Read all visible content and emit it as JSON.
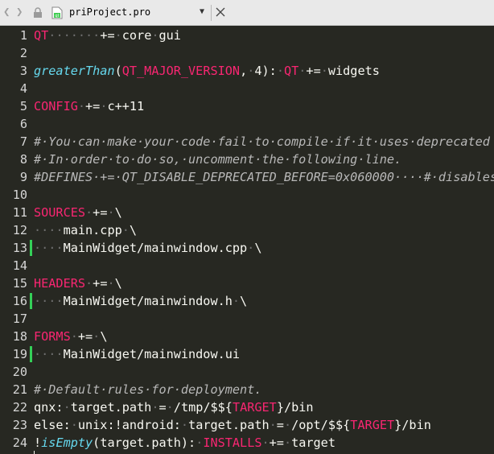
{
  "tabbar": {
    "filename": "priProject.pro",
    "back_icon": "chevron-left-icon",
    "forward_icon": "chevron-right-icon",
    "lock_icon": "lock-icon",
    "file_icon": "qt-project-file-icon",
    "dropdown_icon": "triangle-down-icon",
    "close_icon": "close-icon"
  },
  "colors": {
    "background": "#272822",
    "keyword": "#f92672",
    "function": "#66d9ef",
    "text": "#f8f8f2",
    "comment": "#b8b8b8",
    "whitespace_dot": "#6e6e6e",
    "modified_marker": "#34d058"
  },
  "lines": [
    {
      "n": "1",
      "modified": false,
      "tokens": [
        [
          "kw",
          "QT"
        ],
        [
          "dot",
          "·······"
        ],
        [
          "ph",
          "+="
        ],
        [
          "dot",
          "·"
        ],
        [
          "ph",
          "core"
        ],
        [
          "dot",
          "·"
        ],
        [
          "ph",
          "gui"
        ]
      ]
    },
    {
      "n": "2",
      "modified": false,
      "tokens": []
    },
    {
      "n": "3",
      "modified": false,
      "tokens": [
        [
          "fn",
          "greaterThan"
        ],
        [
          "ph",
          "("
        ],
        [
          "kw",
          "QT_MAJOR_VERSION"
        ],
        [
          "ph",
          ","
        ],
        [
          "dot",
          "·"
        ],
        [
          "ph",
          "4):"
        ],
        [
          "dot",
          "·"
        ],
        [
          "kw",
          "QT"
        ],
        [
          "dot",
          "·"
        ],
        [
          "ph",
          "+="
        ],
        [
          "dot",
          "·"
        ],
        [
          "ph",
          "widgets"
        ]
      ]
    },
    {
      "n": "4",
      "modified": false,
      "tokens": []
    },
    {
      "n": "5",
      "modified": false,
      "tokens": [
        [
          "kw",
          "CONFIG"
        ],
        [
          "dot",
          "·"
        ],
        [
          "ph",
          "+="
        ],
        [
          "dot",
          "·"
        ],
        [
          "ph",
          "c++11"
        ]
      ]
    },
    {
      "n": "6",
      "modified": false,
      "tokens": []
    },
    {
      "n": "7",
      "modified": false,
      "tokens": [
        [
          "cm",
          "#·You·can·make·your·code·fail·to·compile·if·it·uses·deprecated"
        ]
      ]
    },
    {
      "n": "8",
      "modified": false,
      "tokens": [
        [
          "cm",
          "#·In·order·to·do·so,·uncomment·the·following·line."
        ]
      ]
    },
    {
      "n": "9",
      "modified": false,
      "tokens": [
        [
          "cm",
          "#DEFINES·+=·QT_DISABLE_DEPRECATED_BEFORE=0x060000····#·disables"
        ]
      ]
    },
    {
      "n": "10",
      "modified": false,
      "tokens": []
    },
    {
      "n": "11",
      "modified": false,
      "tokens": [
        [
          "kw",
          "SOURCES"
        ],
        [
          "dot",
          "·"
        ],
        [
          "ph",
          "+="
        ],
        [
          "dot",
          "·"
        ],
        [
          "ph",
          "\\"
        ]
      ]
    },
    {
      "n": "12",
      "modified": false,
      "tokens": [
        [
          "dot",
          "····"
        ],
        [
          "ph",
          "main.cpp"
        ],
        [
          "dot",
          "·"
        ],
        [
          "ph",
          "\\"
        ]
      ]
    },
    {
      "n": "13",
      "modified": true,
      "tokens": [
        [
          "dot",
          "····"
        ],
        [
          "ph",
          "MainWidget/mainwindow.cpp"
        ],
        [
          "dot",
          "·"
        ],
        [
          "ph",
          "\\"
        ]
      ]
    },
    {
      "n": "14",
      "modified": false,
      "tokens": []
    },
    {
      "n": "15",
      "modified": false,
      "tokens": [
        [
          "kw",
          "HEADERS"
        ],
        [
          "dot",
          "·"
        ],
        [
          "ph",
          "+="
        ],
        [
          "dot",
          "·"
        ],
        [
          "ph",
          "\\"
        ]
      ]
    },
    {
      "n": "16",
      "modified": true,
      "tokens": [
        [
          "dot",
          "····"
        ],
        [
          "ph",
          "MainWidget/mainwindow.h"
        ],
        [
          "dot",
          "·"
        ],
        [
          "ph",
          "\\"
        ]
      ]
    },
    {
      "n": "17",
      "modified": false,
      "tokens": []
    },
    {
      "n": "18",
      "modified": false,
      "tokens": [
        [
          "kw",
          "FORMS"
        ],
        [
          "dot",
          "·"
        ],
        [
          "ph",
          "+="
        ],
        [
          "dot",
          "·"
        ],
        [
          "ph",
          "\\"
        ]
      ]
    },
    {
      "n": "19",
      "modified": true,
      "tokens": [
        [
          "dot",
          "····"
        ],
        [
          "ph",
          "MainWidget/mainwindow.ui"
        ]
      ]
    },
    {
      "n": "20",
      "modified": false,
      "tokens": []
    },
    {
      "n": "21",
      "modified": false,
      "tokens": [
        [
          "cm",
          "#·Default·rules·for·deployment."
        ]
      ]
    },
    {
      "n": "22",
      "modified": false,
      "tokens": [
        [
          "ph",
          "qnx:"
        ],
        [
          "dot",
          "·"
        ],
        [
          "ph",
          "target.path"
        ],
        [
          "dot",
          "·"
        ],
        [
          "ph",
          "="
        ],
        [
          "dot",
          "·"
        ],
        [
          "ph",
          "/tmp/$${"
        ],
        [
          "kw",
          "TARGET"
        ],
        [
          "ph",
          "}/bin"
        ]
      ]
    },
    {
      "n": "23",
      "modified": false,
      "tokens": [
        [
          "ph",
          "else:"
        ],
        [
          "dot",
          "·"
        ],
        [
          "ph",
          "unix:!android:"
        ],
        [
          "dot",
          "·"
        ],
        [
          "ph",
          "target.path"
        ],
        [
          "dot",
          "·"
        ],
        [
          "ph",
          "="
        ],
        [
          "dot",
          "·"
        ],
        [
          "ph",
          "/opt/$${"
        ],
        [
          "kw",
          "TARGET"
        ],
        [
          "ph",
          "}/bin"
        ]
      ]
    },
    {
      "n": "24",
      "modified": false,
      "tokens": [
        [
          "ph",
          "!"
        ],
        [
          "fn",
          "isEmpty"
        ],
        [
          "ph",
          "(target.path):"
        ],
        [
          "dot",
          "·"
        ],
        [
          "kw",
          "INSTALLS"
        ],
        [
          "dot",
          "·"
        ],
        [
          "ph",
          "+="
        ],
        [
          "dot",
          "·"
        ],
        [
          "ph",
          "target"
        ]
      ]
    }
  ]
}
